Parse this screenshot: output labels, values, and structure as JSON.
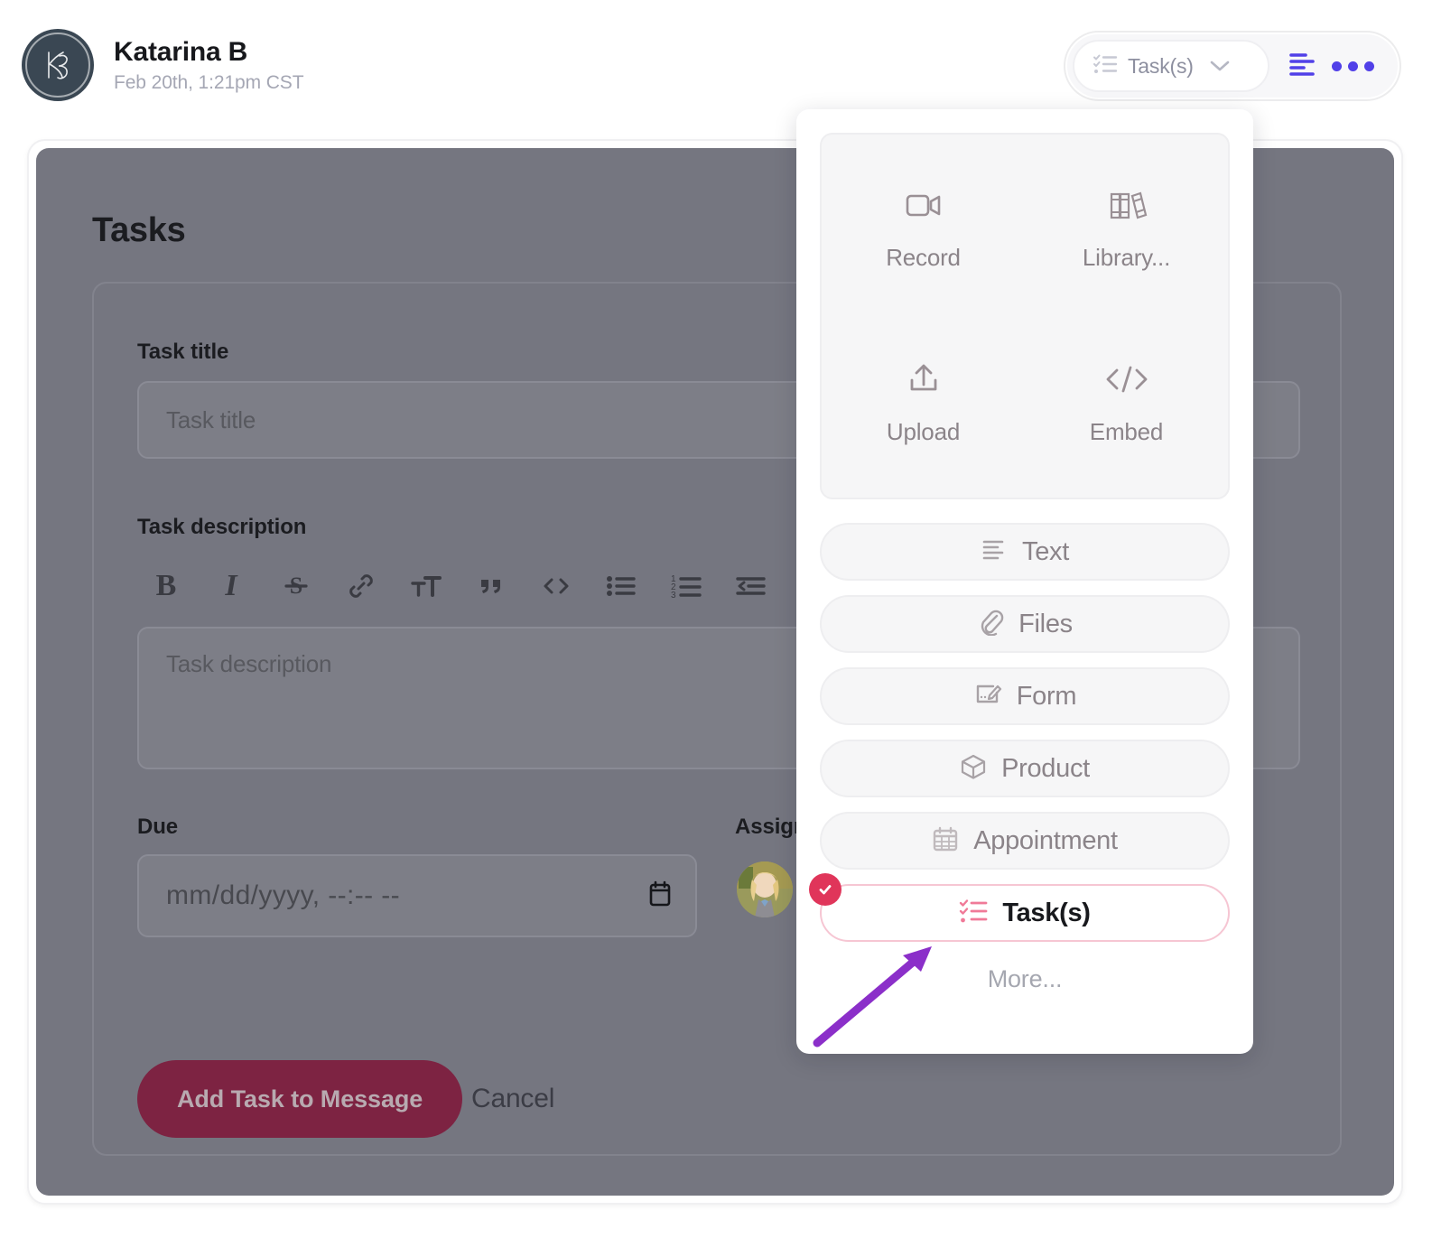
{
  "header": {
    "avatar_initials": "KB",
    "avatar_name": "avatar-monogram",
    "user_name": "Katarina B",
    "timestamp": "Feb 20th, 1:21pm CST",
    "type_select_label": "Task(s)",
    "type_select_icon": "checklist-icon",
    "chevron_icon": "chevron-down-icon",
    "format_icon": "text-align-left-icon",
    "overflow_icon": "more-horizontal-icon",
    "accent_blue": "#5140e8"
  },
  "panel": {
    "section_title": "Tasks",
    "fields": {
      "title_label": "Task title",
      "title_placeholder": "Task title",
      "description_label": "Task description",
      "description_placeholder": "Task description",
      "due_label": "Due",
      "due_value": "mm/dd/yyyy, --:-- --",
      "due_icon": "calendar-icon",
      "assignee_label": "Assign",
      "assignee_avatar": "assignee-avatar"
    },
    "actions": {
      "primary_label": "Add Task to Message",
      "primary_color": "#7d2342",
      "cancel_label": "Cancel"
    },
    "rte_toolbar": [
      {
        "name": "bold-icon",
        "glyph": "B"
      },
      {
        "name": "italic-icon",
        "glyph": "I"
      },
      {
        "name": "strikethrough-icon",
        "glyph": "S"
      },
      {
        "name": "link-icon",
        "glyph": ""
      },
      {
        "name": "text-size-icon",
        "glyph": ""
      },
      {
        "name": "quote-icon",
        "glyph": ""
      },
      {
        "name": "code-icon",
        "glyph": ""
      },
      {
        "name": "bullet-list-icon",
        "glyph": ""
      },
      {
        "name": "numbered-list-icon",
        "glyph": ""
      },
      {
        "name": "outdent-icon",
        "glyph": ""
      },
      {
        "name": "indent-icon",
        "glyph": ""
      }
    ]
  },
  "dropdown": {
    "grid_items": [
      {
        "label": "Record",
        "icon": "video-camera-icon"
      },
      {
        "label": "Library...",
        "icon": "books-icon"
      },
      {
        "label": "Upload",
        "icon": "upload-icon"
      },
      {
        "label": "Embed",
        "icon": "code-brackets-icon"
      }
    ],
    "pill_items": [
      {
        "label": "Text",
        "icon": "text-align-icon",
        "selected": false
      },
      {
        "label": "Files",
        "icon": "paperclip-icon",
        "selected": false
      },
      {
        "label": "Form",
        "icon": "form-edit-icon",
        "selected": false
      },
      {
        "label": "Product",
        "icon": "cube-icon",
        "selected": false
      },
      {
        "label": "Appointment",
        "icon": "calendar-grid-icon",
        "selected": false
      },
      {
        "label": "Task(s)",
        "icon": "checklist-icon",
        "selected": true
      }
    ],
    "more_label": "More...",
    "selected_accent": "#e0355a",
    "selected_border": "#f6c6d3"
  },
  "annotation": {
    "arrow_color": "#8b2fc9",
    "points_to": "Task(s)"
  }
}
